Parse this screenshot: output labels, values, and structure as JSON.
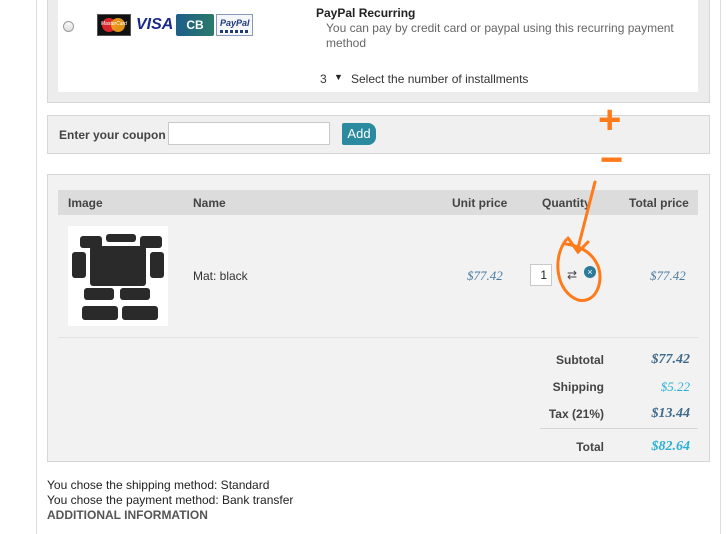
{
  "payment": {
    "method_name": "PayPal Recurring",
    "description": "You can pay by credit card or paypal using this recurring payment method",
    "installments_value": "3",
    "installments_label": "Select the number of installments",
    "card_logos": [
      "mastercard",
      "visa",
      "cb",
      "paypal"
    ],
    "visa_text": "VISA",
    "cb_text": "CB",
    "paypal_text": "PayPal",
    "mastercard_text": "MasterCard"
  },
  "coupon": {
    "label": "Enter your coupon",
    "value": "",
    "button_label": "Add"
  },
  "cart": {
    "headers": {
      "image": "Image",
      "name": "Name",
      "unit_price": "Unit price",
      "quantity": "Quantity",
      "total_price": "Total price"
    },
    "items": [
      {
        "name": "Mat: black",
        "unit_price": "$77.42",
        "quantity": "1",
        "total_price": "$77.42"
      }
    ],
    "summary": {
      "subtotal_label": "Subtotal",
      "subtotal_value": "$77.42",
      "shipping_label": "Shipping",
      "shipping_value": "$5.22",
      "tax_label": "Tax (21%)",
      "tax_value": "$13.44",
      "total_label": "Total",
      "total_value": "$82.64"
    }
  },
  "info": {
    "shipping_line": "You chose the shipping method: Standard",
    "payment_line": "You chose the payment method: Bank transfer",
    "additional_heading": "ADDITIONAL INFORMATION"
  },
  "annotation": {
    "plus": "+",
    "minus": "−"
  },
  "colors": {
    "accent_button": "#2a8aa0",
    "price_blue": "#4a7aa0",
    "highlight_cyan": "#2ab0d8",
    "annotation_orange": "#ff7a1a"
  },
  "icons": [
    "refresh-icon",
    "remove-icon",
    "dropdown-arrow-icon"
  ]
}
